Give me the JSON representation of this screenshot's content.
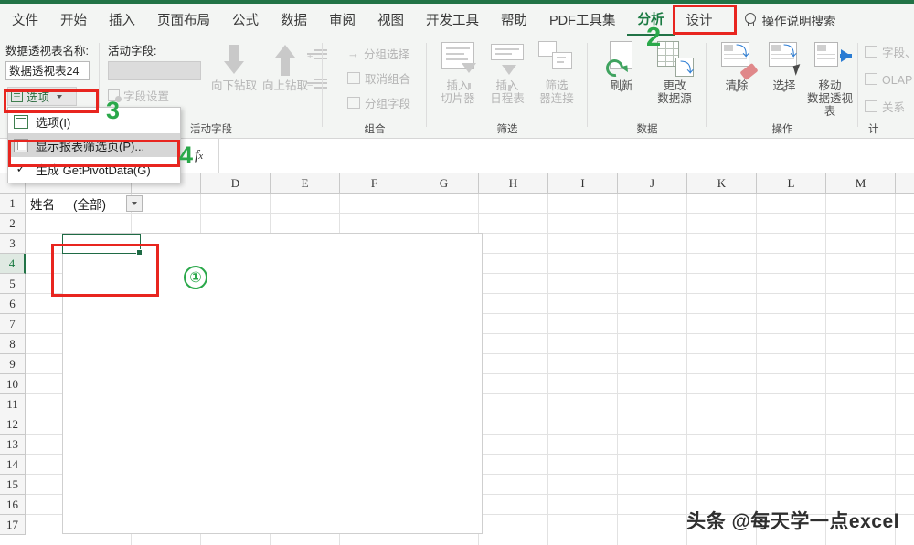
{
  "tabs": [
    {
      "label": "文件",
      "active": false
    },
    {
      "label": "开始",
      "active": false
    },
    {
      "label": "插入",
      "active": false
    },
    {
      "label": "页面布局",
      "active": false
    },
    {
      "label": "公式",
      "active": false
    },
    {
      "label": "数据",
      "active": false
    },
    {
      "label": "审阅",
      "active": false
    },
    {
      "label": "视图",
      "active": false
    },
    {
      "label": "开发工具",
      "active": false
    },
    {
      "label": "帮助",
      "active": false
    },
    {
      "label": "PDF工具集",
      "active": false
    },
    {
      "label": "分析",
      "active": true
    },
    {
      "label": "设计",
      "active": false
    }
  ],
  "tell_me": {
    "icon": "lightbulb-icon",
    "label": "操作说明搜索"
  },
  "ribbon": {
    "pivot_name_group": {
      "label": "数据透视表名称:",
      "value": "数据透视表24",
      "options_button": "选项",
      "group_title": ""
    },
    "active_field_group": {
      "label": "活动字段:",
      "value": "",
      "field_settings": "字段设置",
      "drill_down": "向下钻取",
      "drill_up": "向上钻取",
      "expand": "展开字段",
      "collapse": "折叠字段",
      "group_title": "活动字段"
    },
    "group_group": {
      "group_selection": "分组选择",
      "ungroup": "取消组合",
      "group_field": "分组字段",
      "group_title": "组合"
    },
    "filter_group": {
      "insert_slicer": "插入\n切片器",
      "insert_slicer_l1": "插入",
      "insert_slicer_l2": "切片器",
      "insert_timeline_l1": "插入",
      "insert_timeline_l2": "日程表",
      "filter_connections_l1": "筛选",
      "filter_connections_l2": "器连接",
      "group_title": "筛选"
    },
    "data_group": {
      "refresh": "刷新",
      "change_source_l1": "更改",
      "change_source_l2": "数据源",
      "group_title": "数据"
    },
    "actions_group": {
      "clear": "清除",
      "select": "选择",
      "move_l1": "移动",
      "move_l2": "数据透视表",
      "group_title": "操作"
    },
    "calc_group": {
      "fields_items": "字段、项",
      "olap": "OLAP 工",
      "relations": "关系",
      "group_title": "计"
    }
  },
  "dropdown_menu": {
    "items": [
      {
        "label": "选项(I)",
        "icon": "options-icon",
        "highlighted": false,
        "checked": false
      },
      {
        "label": "显示报表筛选页(P)...",
        "icon": "report-pages-icon",
        "highlighted": true,
        "checked": false
      },
      {
        "label": "生成 GetPivotData(G)",
        "icon": "check-icon",
        "highlighted": false,
        "checked": true
      }
    ]
  },
  "formula_bar": {
    "name_box_value": "",
    "fx_label": "fx",
    "formula_value": ""
  },
  "sheet": {
    "columns": [
      "D",
      "E",
      "F",
      "G",
      "H",
      "I",
      "J",
      "K",
      "L",
      "M"
    ],
    "rows": [
      "1",
      "2",
      "3",
      "4",
      "5",
      "6",
      "7",
      "8",
      "9",
      "10",
      "11",
      "12",
      "13",
      "14",
      "15",
      "16",
      "17"
    ],
    "selected_row": "4",
    "cells": [
      {
        "ref": "A1",
        "value": "姓名"
      },
      {
        "ref": "B1",
        "value": "(全部)"
      }
    ],
    "filter_button": "filter-dropdown-icon",
    "selected_cell_ref": "B4"
  },
  "annotations": {
    "marker_1": "①",
    "marker_2": "2",
    "marker_3": "3",
    "marker_4": "4"
  },
  "watermark": "头条 @每天学一点excel",
  "colors": {
    "excel_green": "#217346",
    "annotation_red": "#e8251f",
    "annotation_green": "#2aa84a",
    "ribbon_bg": "#f3f5f3"
  }
}
